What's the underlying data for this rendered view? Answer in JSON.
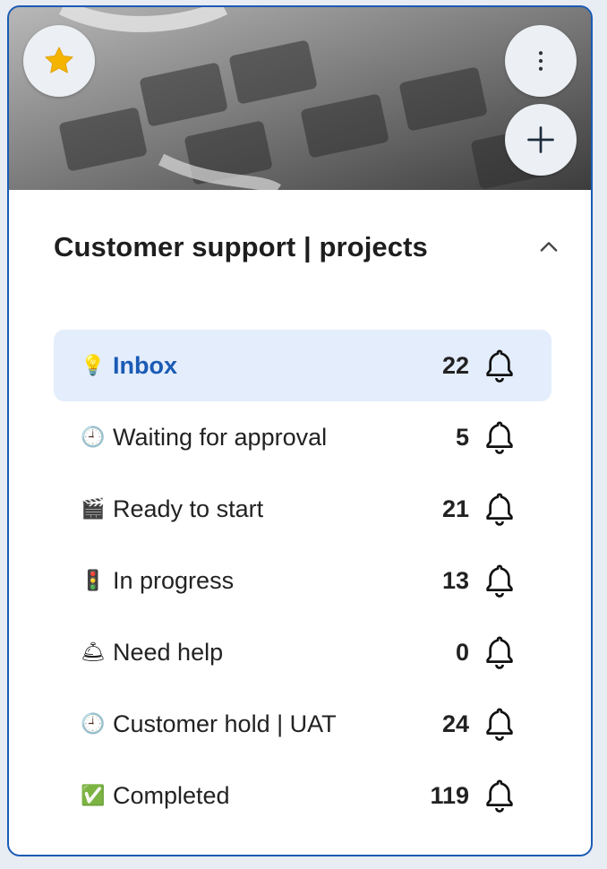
{
  "card": {
    "title": "Customer support | projects"
  },
  "actions": {
    "favorite_icon": "star-icon",
    "more_icon": "more-vert-icon",
    "add_icon": "plus-icon",
    "collapse_icon": "chevron-up-icon"
  },
  "colors": {
    "accent": "#1a5bb5",
    "active_row_bg": "#e3edfc",
    "star": "#f5b400"
  },
  "rows": [
    {
      "emoji": "💡",
      "label": "Inbox",
      "count": "22",
      "active": true
    },
    {
      "emoji": "🕘",
      "label": "Waiting for approval",
      "count": "5",
      "active": false
    },
    {
      "emoji": "🎬",
      "label": "Ready to start",
      "count": "21",
      "active": false
    },
    {
      "emoji": "🚦",
      "label": "In progress",
      "count": "13",
      "active": false
    },
    {
      "emoji": "🛎",
      "label": "Need help",
      "count": "0",
      "active": false
    },
    {
      "emoji": "🕘",
      "label": "Customer hold | UAT",
      "count": "24",
      "active": false
    },
    {
      "emoji": "✅",
      "label": "Completed",
      "count": "119",
      "active": false
    }
  ]
}
